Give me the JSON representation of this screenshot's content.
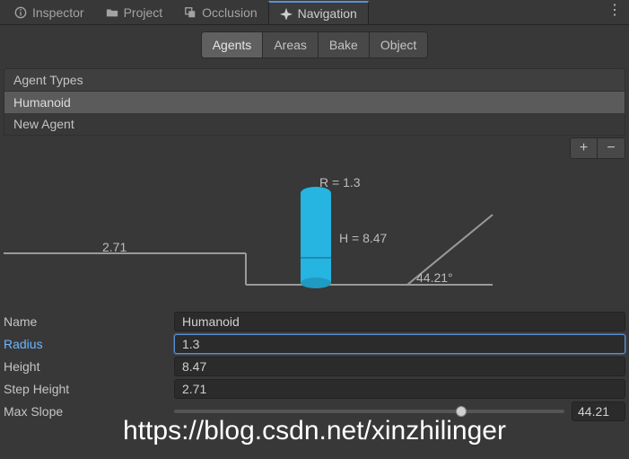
{
  "colors": {
    "agent_cyl": "#26b4e0"
  },
  "window_tabs": [
    {
      "label": "Inspector",
      "active": false
    },
    {
      "label": "Project",
      "active": false
    },
    {
      "label": "Occlusion",
      "active": false
    },
    {
      "label": "Navigation",
      "active": true
    }
  ],
  "subtabs": [
    {
      "label": "Agents",
      "active": true
    },
    {
      "label": "Areas",
      "active": false
    },
    {
      "label": "Bake",
      "active": false
    },
    {
      "label": "Object",
      "active": false
    }
  ],
  "agent_types": {
    "header": "Agent Types",
    "items": [
      {
        "label": "Humanoid",
        "selected": true
      },
      {
        "label": "New Agent",
        "selected": false
      }
    ]
  },
  "diagram": {
    "r_label": "R = 1.3",
    "h_label": "H = 8.47",
    "step_label": "2.71",
    "slope_label": "44.21°"
  },
  "properties": {
    "name": {
      "label": "Name",
      "value": "Humanoid"
    },
    "radius": {
      "label": "Radius",
      "value": "1.3"
    },
    "height": {
      "label": "Height",
      "value": "8.47"
    },
    "stepHeight": {
      "label": "Step Height",
      "value": "2.71"
    },
    "maxSlope": {
      "label": "Max Slope",
      "value": "44.21",
      "frac": 0.736
    }
  },
  "watermark": "https://blog.csdn.net/xinzhilinger"
}
